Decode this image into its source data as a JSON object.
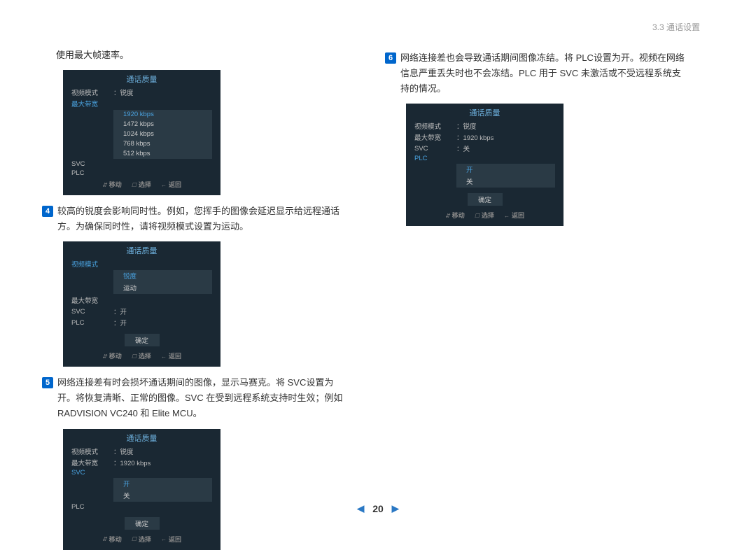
{
  "header": {
    "section": "3.3 通话设置"
  },
  "colL": {
    "intro": "使用最大帧速率。",
    "panel1": {
      "title": "通话质量",
      "rows": [
        {
          "label": "视频模式",
          "val": "：锐度",
          "hl": false
        },
        {
          "label": "最大带宽",
          "val": "",
          "hl": true
        },
        {
          "label": "SVC",
          "val": "",
          "hl": false
        },
        {
          "label": "PLC",
          "val": "",
          "hl": false
        }
      ],
      "options": [
        "1920 kbps",
        "1472 kbps",
        "1024 kbps",
        "768 kbps",
        "512 kbps"
      ],
      "selIdx": 0,
      "ok": "",
      "footer": {
        "move": "移动",
        "sel": "选择",
        "back": "返回"
      }
    },
    "step4": {
      "n": "4",
      "t": "较高的锐度会影响同时性。例如，您挥手的图像会延迟显示给远程通话方。为确保同时性，请将视频模式设置为运动。"
    },
    "panel2": {
      "title": "通话质量",
      "rows": [
        {
          "label": "视频模式",
          "val": "",
          "hl": true
        },
        {
          "label": "最大带宽",
          "val": "",
          "hl": false
        },
        {
          "label": "SVC",
          "val": "：开",
          "hl": false
        },
        {
          "label": "PLC",
          "val": "：开",
          "hl": false
        }
      ],
      "options": [
        "锐度",
        "运动"
      ],
      "selIdx": 0,
      "ok": "确定",
      "footer": {
        "move": "移动",
        "sel": "选择",
        "back": "返回"
      }
    },
    "step5": {
      "n": "5",
      "t": "网络连接差有时会损坏通话期间的图像，显示马赛克。将 SVC设置为开。将恢复清晰、正常的图像。SVC 在受到远程系统支持时生效；例如 RADVISION VC240 和 Elite MCU。"
    },
    "panel3": {
      "title": "通话质量",
      "rows": [
        {
          "label": "视频模式",
          "val": "：锐度",
          "hl": false
        },
        {
          "label": "最大带宽",
          "val": "：1920 kbps",
          "hl": false
        },
        {
          "label": "SVC",
          "val": "",
          "hl": true
        },
        {
          "label": "PLC",
          "val": "",
          "hl": false
        }
      ],
      "options": [
        "开",
        "关"
      ],
      "selIdx": 0,
      "ok": "确定",
      "footer": {
        "move": "移动",
        "sel": "选择",
        "back": "返回"
      }
    }
  },
  "colR": {
    "step6": {
      "n": "6",
      "t": "网络连接差也会导致通话期间图像冻结。将 PLC设置为开。视频在网络信息严重丢失时也不会冻结。PLC 用于 SVC 未激活或不受远程系统支持的情况。"
    },
    "panel4": {
      "title": "通话质量",
      "rows": [
        {
          "label": "视频模式",
          "val": "：锐度",
          "hl": false
        },
        {
          "label": "最大带宽",
          "val": "：1920 kbps",
          "hl": false
        },
        {
          "label": "SVC",
          "val": "：关",
          "hl": false
        },
        {
          "label": "PLC",
          "val": "",
          "hl": true
        }
      ],
      "options": [
        "开",
        "关"
      ],
      "selIdx": 0,
      "ok": "确定",
      "footer": {
        "move": "移动",
        "sel": "选择",
        "back": "返回"
      }
    }
  },
  "pager": {
    "page": "20"
  }
}
